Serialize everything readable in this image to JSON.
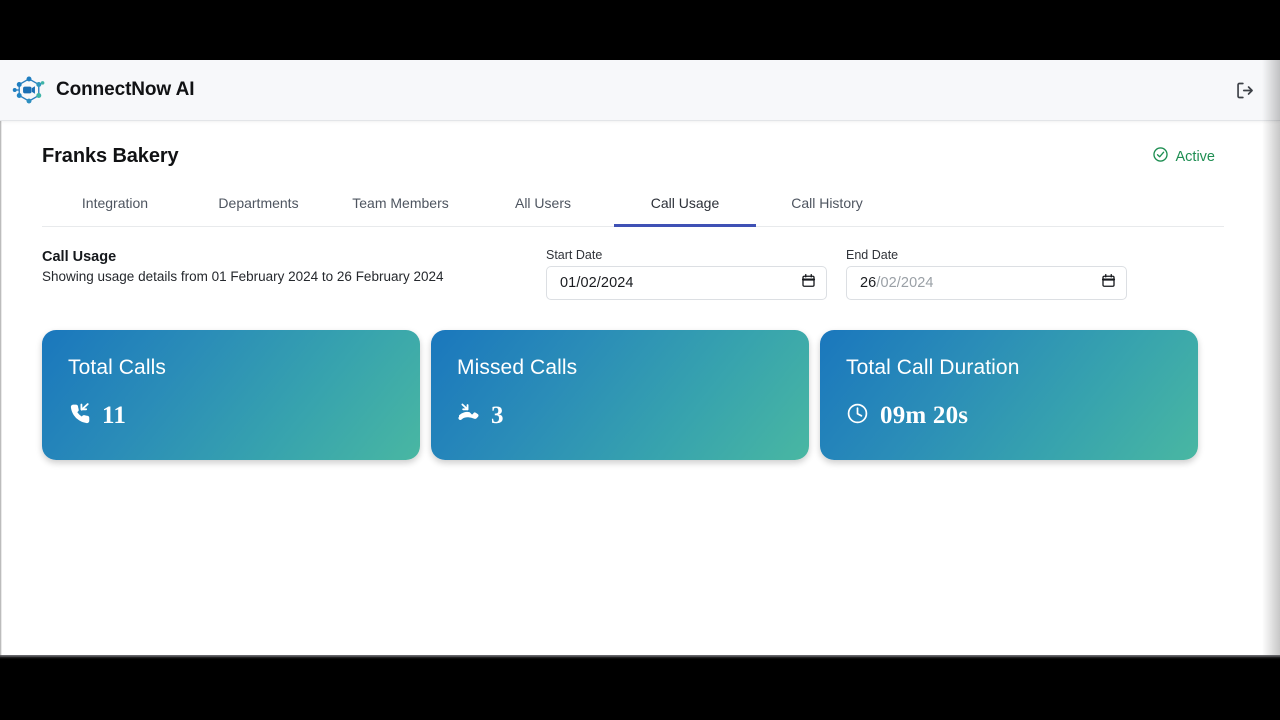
{
  "app": {
    "brand_name": "ConnectNow AI",
    "logo_icon": "network-nodes-camera-logo",
    "logout_icon": "logout-icon"
  },
  "page": {
    "org_title": "Franks Bakery",
    "status": {
      "label": "Active",
      "icon": "check-circle-icon",
      "color": "#1e8e52"
    }
  },
  "tabs": {
    "items": [
      {
        "label": "Integration",
        "active": false
      },
      {
        "label": "Departments",
        "active": false
      },
      {
        "label": "Team Members",
        "active": false
      },
      {
        "label": "All Users",
        "active": false
      },
      {
        "label": "Call Usage",
        "active": true
      },
      {
        "label": "Call History",
        "active": false
      }
    ],
    "active_underline_color": "#3f51b5"
  },
  "usage": {
    "title": "Call Usage",
    "subtitle": "Showing usage details from 01 February 2024 to 26 February 2024",
    "start_date": {
      "label": "Start Date",
      "value": "01/02/2024",
      "value_head": "01",
      "value_tail": "/02/2024",
      "placeholder": "dd/mm/yyyy",
      "icon": "calendar-icon"
    },
    "end_date": {
      "label": "End Date",
      "value": "26/02/2024",
      "value_head": "26",
      "value_tail": "/02/2024",
      "placeholder": "dd/mm/yyyy",
      "icon": "calendar-icon"
    }
  },
  "cards": [
    {
      "title": "Total Calls",
      "value": "11",
      "icon": "phone-incoming-icon"
    },
    {
      "title": "Missed Calls",
      "value": "3",
      "icon": "phone-missed-icon"
    },
    {
      "title": "Total Call Duration",
      "value": "09m 20s",
      "icon": "clock-icon"
    }
  ],
  "theme": {
    "card_gradient_start": "#1a77bd",
    "card_gradient_end": "#49b7a2",
    "accent": "#3f51b5",
    "header_bg": "#f7f8fa"
  }
}
